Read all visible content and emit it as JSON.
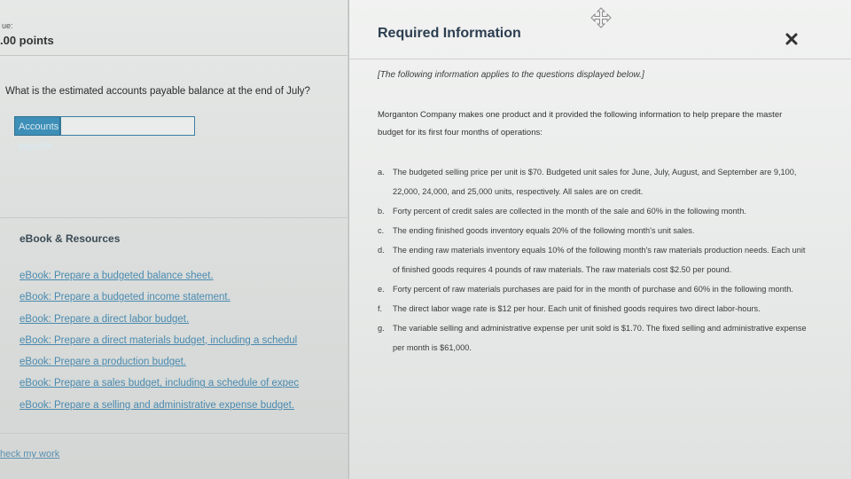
{
  "left": {
    "due_label": "ue:",
    "points": ".00 points",
    "question": "What is the estimated accounts payable balance at the end of July?",
    "ap_label": "Accounts payable",
    "ap_value": "",
    "ebook_heading": "eBook & Resources",
    "ebook_links": [
      "eBook: Prepare a budgeted balance sheet.",
      "eBook: Prepare a budgeted income statement.",
      "eBook: Prepare a direct labor budget.",
      "eBook: Prepare a direct materials budget, including a schedul",
      "eBook: Prepare a production budget.",
      "eBook: Prepare a sales budget, including a schedule of expec",
      "eBook: Prepare a selling and administrative expense budget."
    ],
    "check_my_work": "heck my work"
  },
  "panel": {
    "title": "Required Information",
    "note": "[The following information applies to the questions displayed below.]",
    "intro": "Morganton Company makes one product and it provided the following information to help prepare the master budget for its first four months of operations:",
    "items": [
      {
        "letter": "a.",
        "text": "The budgeted selling price per unit is $70. Budgeted unit sales for June, July, August, and September are 9,100, 22,000, 24,000, and 25,000 units, respectively. All sales are on credit."
      },
      {
        "letter": "b.",
        "text": "Forty percent of credit sales are collected in the month of the sale and 60% in the following month."
      },
      {
        "letter": "c.",
        "text": "The ending finished goods inventory equals 20% of the following month's unit sales."
      },
      {
        "letter": "d.",
        "text": "The ending raw materials inventory equals 10% of the following month's raw materials production needs. Each unit of finished goods requires 4 pounds of raw materials. The raw materials cost $2.50 per pound."
      },
      {
        "letter": "e.",
        "text": "Forty percent of raw materials purchases are paid for in the month of purchase and 60% in the following month."
      },
      {
        "letter": "f.",
        "text": "The direct labor wage rate is $12 per hour. Each unit of finished goods requires two direct labor-hours."
      },
      {
        "letter": "g.",
        "text": "The variable selling and administrative expense per unit sold is $1.70. The fixed selling and administrative expense per month is $61,000."
      }
    ]
  },
  "icons": {
    "move": "move-icon",
    "close": "close-icon"
  },
  "colors": {
    "accent": "#3e8fb7",
    "link": "#4a8ab0",
    "title": "#2c3e50"
  }
}
